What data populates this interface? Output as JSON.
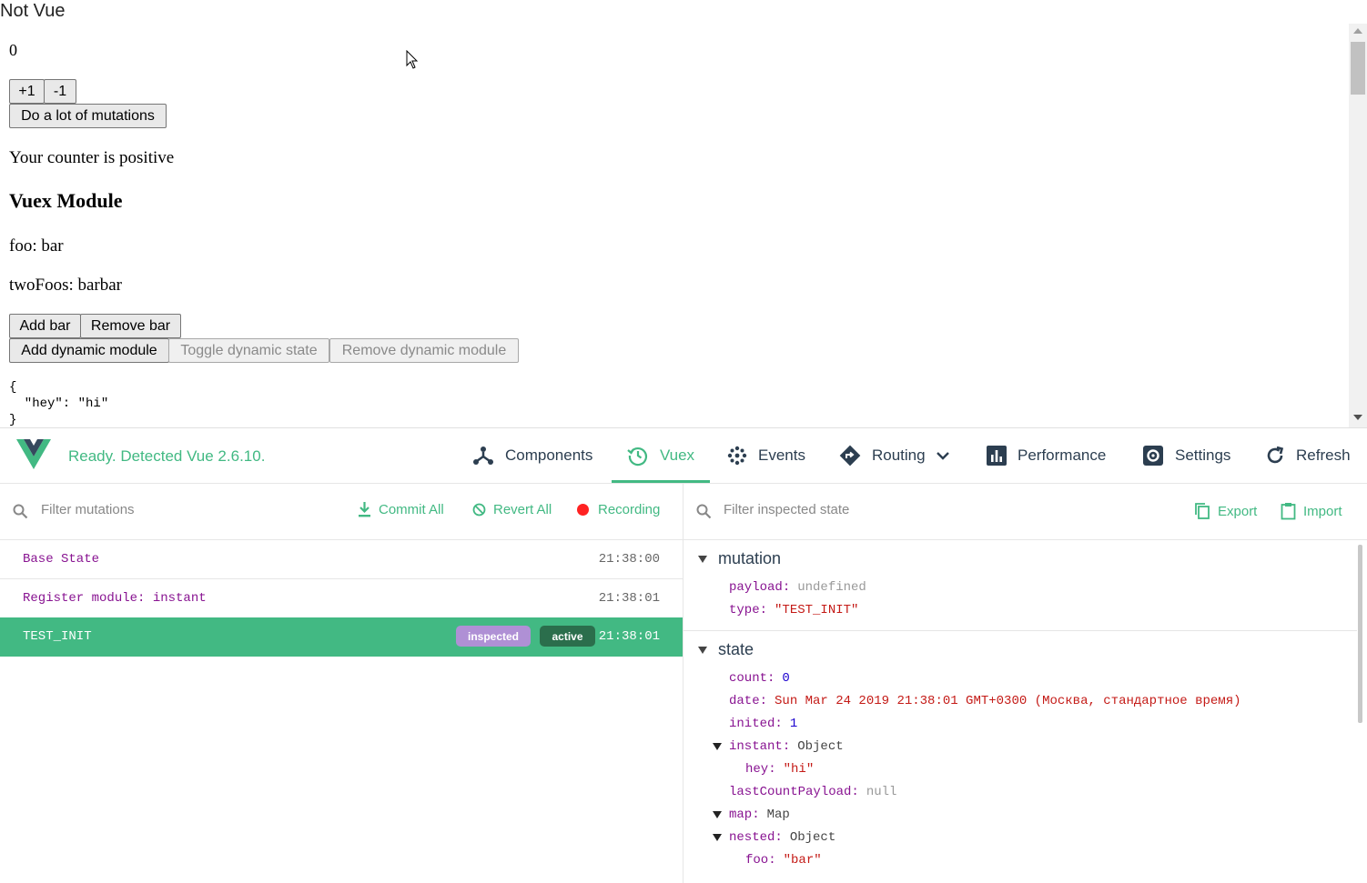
{
  "page": {
    "title": "Not Vue",
    "counter": "0",
    "buttons": {
      "plus": "+1",
      "minus": "-1",
      "lots": "Do a lot of mutations",
      "add_bar": "Add bar",
      "remove_bar": "Remove bar",
      "add_dynamic": "Add dynamic module",
      "toggle_dynamic": "Toggle dynamic state",
      "remove_dynamic": "Remove dynamic module"
    },
    "counter_text": "Your counter is positive",
    "module_heading": "Vuex Module",
    "foo_line": "foo: bar",
    "twofoos_line": "twoFoos: barbar",
    "json_pre": "{\n  \"hey\": \"hi\"\n}"
  },
  "devtools": {
    "status": "Ready. Detected Vue 2.6.10.",
    "tabs": [
      {
        "label": "Components",
        "icon": "components-icon"
      },
      {
        "label": "Vuex",
        "icon": "history-icon"
      },
      {
        "label": "Events",
        "icon": "events-icon"
      },
      {
        "label": "Routing",
        "icon": "routing-icon"
      },
      {
        "label": "Performance",
        "icon": "bar-chart-icon"
      },
      {
        "label": "Settings",
        "icon": "gear-icon"
      },
      {
        "label": "Refresh",
        "icon": "refresh-icon"
      }
    ],
    "left": {
      "filter_placeholder": "Filter mutations",
      "commit_all": "Commit All",
      "revert_all": "Revert All",
      "recording": "Recording",
      "mutations": [
        {
          "name": "Base State",
          "time": "21:38:00"
        },
        {
          "name": "Register module: instant",
          "time": "21:38:01"
        },
        {
          "name": "TEST_INIT",
          "time": "21:38:01",
          "badges": [
            "inspected",
            "active"
          ]
        }
      ]
    },
    "right": {
      "filter_placeholder": "Filter inspected state",
      "export": "Export",
      "import": "Import",
      "mutation_section": {
        "title": "mutation",
        "props": [
          {
            "key": "payload",
            "value": "undefined"
          },
          {
            "key": "type",
            "value": "\"TEST_INIT\""
          }
        ]
      },
      "state_section": {
        "title": "state",
        "props": [
          {
            "key": "count",
            "value": "0"
          },
          {
            "key": "date",
            "value": "Sun Mar 24 2019 21:38:01 GMT+0300 (Москва, стандартное время)"
          },
          {
            "key": "inited",
            "value": "1"
          },
          {
            "key": "instant",
            "value": "Object"
          },
          {
            "key": "hey",
            "value": "\"hi\""
          },
          {
            "key": "lastCountPayload",
            "value": "null"
          },
          {
            "key": "map",
            "value": "Map"
          },
          {
            "key": "nested",
            "value": "Object"
          },
          {
            "key": "foo",
            "value": "\"bar\""
          }
        ]
      }
    }
  },
  "colors": {
    "accent": "#42b983",
    "key": "#881391",
    "string": "#c41a16",
    "number": "#1c00cf",
    "badge_inspected": "#af90d5",
    "badge_active": "#2b6e4c",
    "recording_dot": "#ff2222"
  }
}
